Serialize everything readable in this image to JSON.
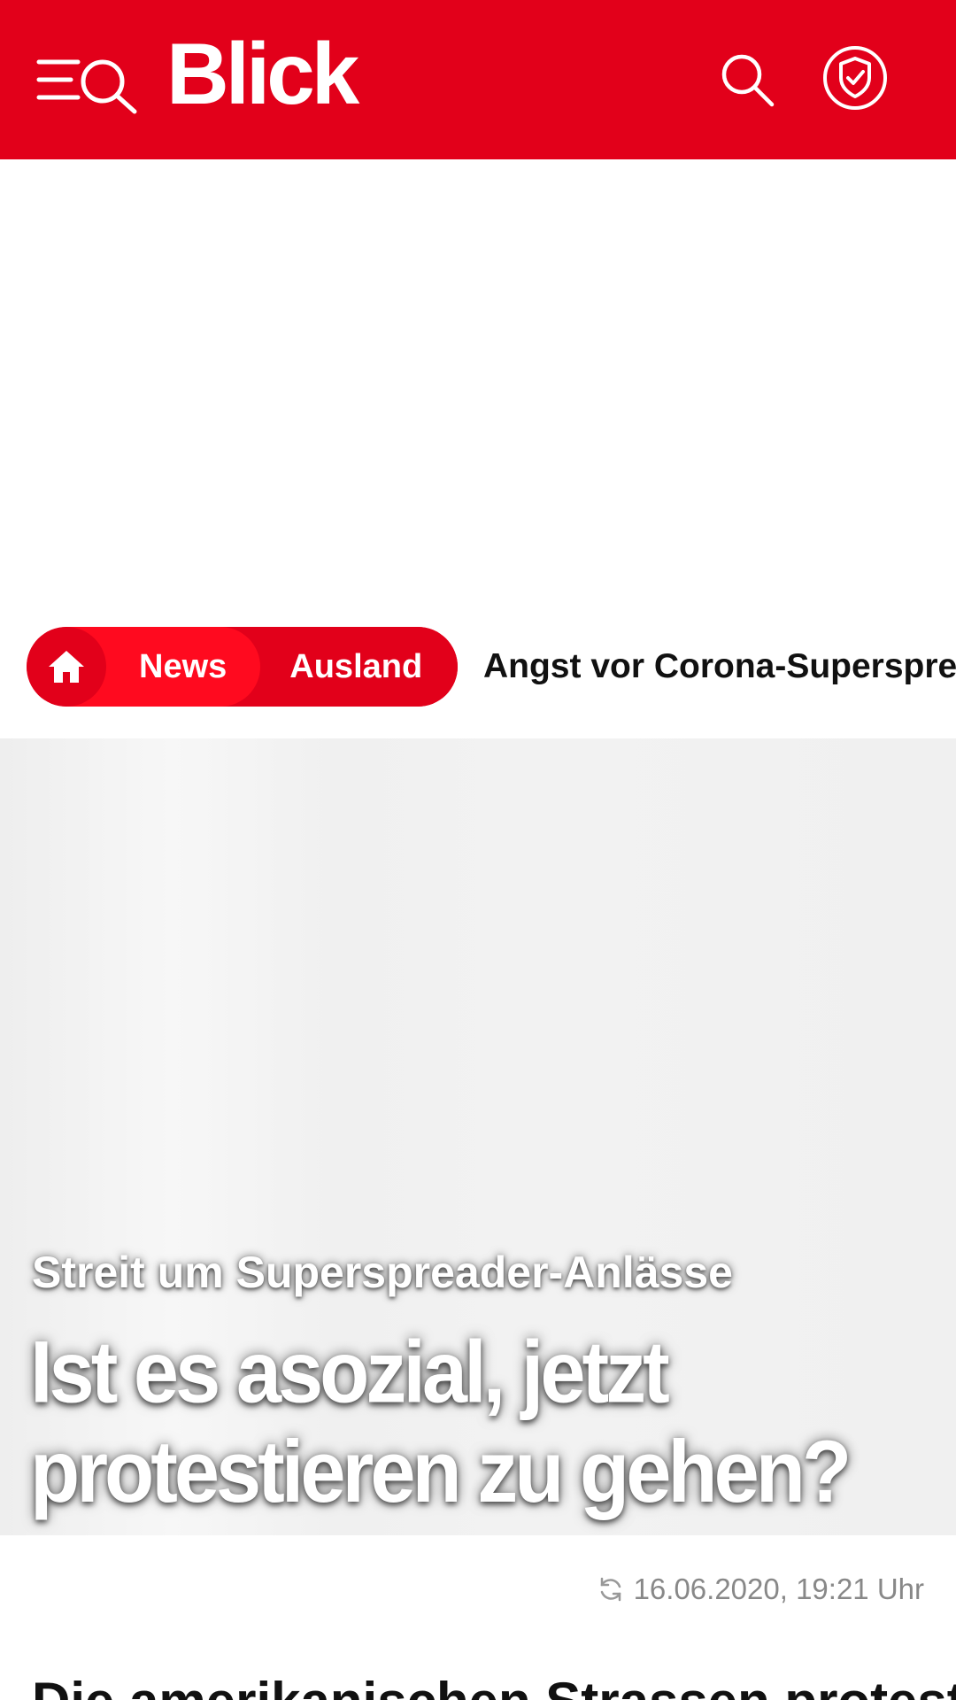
{
  "header": {
    "logo_text": "Blick",
    "brand_color": "#e2001a",
    "menu_icon": "menu-search-icon",
    "search_icon": "search-icon",
    "shield_icon": "shield-check-icon"
  },
  "breadcrumb": {
    "home_icon": "home-icon",
    "items": [
      "News",
      "Ausland"
    ],
    "article_title": "Angst vor Corona-Superspreader-Anlässen"
  },
  "article": {
    "kicker": "Streit um Superspreader-Anlässe",
    "headline_line1": "Ist es asozial, jetzt",
    "headline_line2": "protestieren zu gehen?",
    "timestamp": "16.06.2020, 19:21 Uhr",
    "timestamp_icon": "refresh-icon",
    "lead_partial": "Die amerikanischen Strassen protest"
  }
}
